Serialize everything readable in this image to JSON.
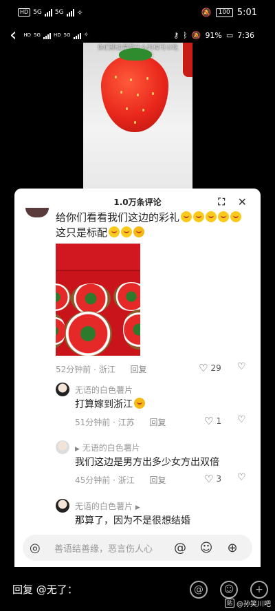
{
  "outer_status": {
    "left_badges": [
      "HD",
      "5G",
      "5G"
    ],
    "time": "5:01",
    "battery": "100"
  },
  "inner_status": {
    "left_badges": [
      "HD",
      "5G",
      "HD",
      "5G"
    ],
    "battery_percent": "91%",
    "time": "7:36"
  },
  "video": {
    "caption_line1": "你们那边草莓什么时候可以吃",
    "caption_line2": "河南的草莓"
  },
  "panel": {
    "title": "1.0万条评论",
    "expand_icon": "expand-icon",
    "close_icon": "close-icon"
  },
  "main_comment": {
    "line1": "给你们看看我们这边的彩礼",
    "line2": "这只是标配",
    "time_location": "52分钟前 · 浙江",
    "reply_label": "回复",
    "likes": "29"
  },
  "replies": [
    {
      "name": "无语的白色薯片",
      "text": "打算嫁到浙江",
      "time_location": "51分钟前 · 江苏",
      "reply_label": "回复",
      "likes": "1"
    },
    {
      "name": "无语的白色薯片",
      "text": "我们这边是男方出多少女方出双倍",
      "time_location": "45分钟前 · 浙江",
      "reply_label": "回复",
      "likes": "3"
    },
    {
      "name": "无语的白色薯片",
      "text": "那算了，因为不是很想结婚"
    }
  ],
  "input": {
    "placeholder": "善语结善缘，恶言伤人心"
  },
  "bottom": {
    "reply_label": "回复 @无了：",
    "watermark": "@孙笑川吧"
  }
}
